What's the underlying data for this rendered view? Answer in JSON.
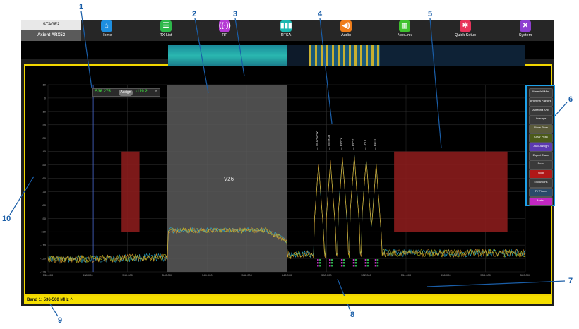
{
  "device": {
    "name": "STAGE2",
    "model": "Axient ARX52"
  },
  "nav": [
    {
      "label": "Home",
      "icon": "home-icon",
      "glyph": "⌂",
      "color": "#1e8fe0",
      "x": 151
    },
    {
      "label": "TX List",
      "icon": "list-icon",
      "glyph": "☰",
      "color": "#2db84a",
      "x": 235
    },
    {
      "label": "RF",
      "icon": "rf-icon",
      "glyph": "((·))",
      "color": "#b53ad4",
      "x": 318
    },
    {
      "label": "RTSA",
      "icon": "rtsa-icon",
      "glyph": "▮▮▮",
      "color": "#1bb7b0",
      "x": 405
    },
    {
      "label": "Audio",
      "icon": "speaker-icon",
      "glyph": "◀)",
      "color": "#f07d1a",
      "x": 490
    },
    {
      "label": "NexLink",
      "icon": "nexlink-icon",
      "glyph": "▥",
      "color": "#3fc22e",
      "x": 573
    },
    {
      "label": "Quick Setup",
      "icon": "gear-icon",
      "glyph": "✲",
      "color": "#e8335a",
      "x": 659
    },
    {
      "label": "System",
      "icon": "wrench-icon",
      "glyph": "✕",
      "color": "#8d3fd0",
      "x": 744
    }
  ],
  "time_display": "--:--:--:--",
  "band_label": "Band 1: 536-560 MHz ^",
  "tooltip": {
    "freq": "538.275",
    "assign": "Assign",
    "level": "-119.2",
    "close": "×"
  },
  "tv_label": "TV26",
  "side_buttons": [
    {
      "label": "Waterfall Mini",
      "color": "#3a3a3a"
    },
    {
      "label": "Antenna Pair A/B",
      "color": "#3a3a3a"
    },
    {
      "label": "Antenna A+B",
      "color": "#3a3a3a"
    },
    {
      "label": "Average",
      "color": "#3a3a3a"
    },
    {
      "label": "Show Peak",
      "color": "#5a5a3a"
    },
    {
      "label": "Clear Peak",
      "color": "#4c5a1a"
    },
    {
      "label": "Auto Assign",
      "color": "#5c3ab0"
    },
    {
      "label": "Export Trace",
      "color": "#3a3a3a"
    },
    {
      "label": "Scan",
      "color": "#3a3a3a"
    },
    {
      "label": "Stop",
      "color": "#b01818"
    },
    {
      "label": "Exclusions",
      "color": "#3a3a3a"
    },
    {
      "label": "TV Finder",
      "color": "#2a4a6a"
    },
    {
      "label": "Meter",
      "color": "#c327c3"
    }
  ],
  "callouts": [
    "1",
    "2",
    "3",
    "4",
    "5",
    "6",
    "7",
    "8",
    "9",
    "10"
  ],
  "chart_data": {
    "type": "line",
    "x_range": [
      536,
      560
    ],
    "y_range": [
      -130,
      10
    ],
    "x_ticks": [
      "536.000",
      "538.000",
      "540.000",
      "542.000",
      "544.000",
      "546.000",
      "548.000",
      "550.000",
      "552.000",
      "554.000",
      "556.000",
      "558.000",
      "560.000"
    ],
    "y_ticks": [
      "10",
      "0",
      "-10",
      "-20",
      "-30",
      "-40",
      "-50",
      "-60",
      "-70",
      "-80",
      "-90",
      "-100",
      "-110",
      "-120",
      "-130"
    ],
    "tx_labels": [
      "LEADVOX",
      "GUITAR",
      "BVOX",
      "RICK",
      "JED",
      "PAUL"
    ],
    "tx_freqs": [
      549.6,
      550.2,
      550.8,
      551.4,
      552.0,
      552.5
    ],
    "tx_peak_dbm": [
      -50,
      -48,
      -45,
      -44,
      -46,
      -50
    ],
    "exclusion_zones": [
      [
        539.7,
        540.6
      ],
      [
        553.4,
        559.1
      ]
    ],
    "tv_channel": [
      542.0,
      548.0
    ]
  }
}
